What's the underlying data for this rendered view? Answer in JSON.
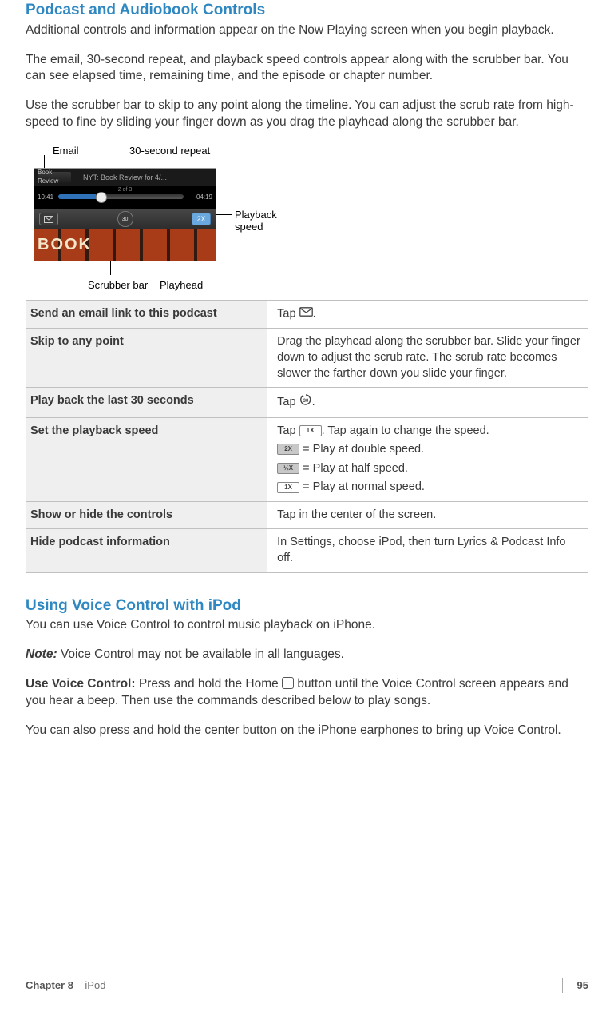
{
  "section1": {
    "title": "Podcast and Audiobook Controls",
    "p1": "Additional controls and information appear on the Now Playing screen when you begin playback.",
    "p2": "The email, 30-second repeat, and playback speed controls appear along with the scrubber bar. You can see elapsed time, remaining time, and the episode or chapter number.",
    "p3": "Use the scrubber bar to skip to any point along the timeline. You can adjust the scrub rate from high-speed to fine by sliding your finger down as you drag the playhead along the scrubber bar."
  },
  "figure": {
    "callouts": {
      "email": "Email",
      "repeat": "30-second repeat",
      "speed": "Playback speed",
      "scrubber": "Scrubber bar",
      "playhead": "Playhead"
    },
    "screenshot": {
      "back_label": "Book Review",
      "title": "NYT: Book Review for 4/...",
      "track": "2 of 3",
      "elapsed": "10:41",
      "remaining": "-04:19",
      "speed_badge": "2X",
      "art_text": "BOOK"
    }
  },
  "table": {
    "rows": [
      {
        "action": "Send an email link to this podcast",
        "detail_pre": "Tap ",
        "icon": "mail",
        "detail_post": "."
      },
      {
        "action": "Skip to any point",
        "detail": "Drag the playhead along the scrubber bar. Slide your finger down to adjust the scrub rate. The scrub rate becomes slower the farther down you slide your finger."
      },
      {
        "action": "Play back the last 30 seconds",
        "detail_pre": "Tap ",
        "icon": "rewind30",
        "detail_post": "."
      },
      {
        "action": "Set the playback speed",
        "lines": {
          "l1_pre": "Tap ",
          "l1_badge": "1X",
          "l1_post": ". Tap again to change the speed.",
          "l2_badge": "2X",
          "l2_post": " = Play at double speed.",
          "l3_badge": "½X",
          "l3_post": " = Play at half speed.",
          "l4_badge": "1X",
          "l4_post": " = Play at normal speed."
        }
      },
      {
        "action": "Show or hide the controls",
        "detail": "Tap in the center of the screen."
      },
      {
        "action": "Hide podcast information",
        "detail": "In Settings, choose iPod, then turn Lyrics & Podcast Info off."
      }
    ]
  },
  "section2": {
    "title": "Using Voice Control with iPod",
    "p1": "You can use Voice Control to control music playback on iPhone.",
    "note_label": "Note:",
    "note_text": "  Voice Control may not be available in all languages.",
    "use_label": "Use Voice Control:",
    "use_text": "  Press and hold the Home ",
    "use_text2": " button until the Voice Control screen appears and you hear a beep. Then use the commands described below to play songs.",
    "p3": "You can also press and hold the center button on the iPhone earphones to bring up Voice Control."
  },
  "footer": {
    "chapter_label": "Chapter 8",
    "chapter_name": "iPod",
    "page": "95"
  }
}
